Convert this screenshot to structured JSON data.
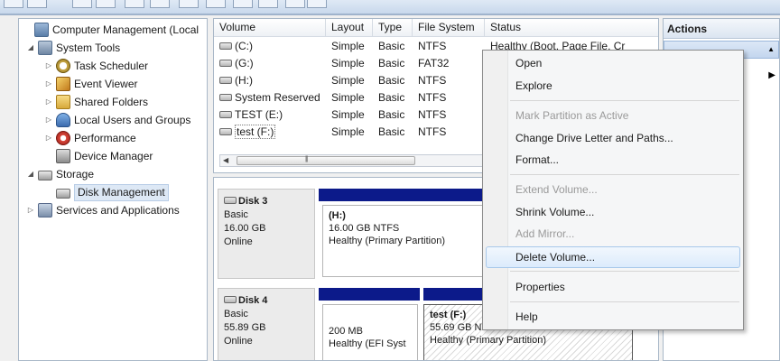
{
  "tree": {
    "items": [
      {
        "label": "Computer Management (Local",
        "icon": "computer-management-icon",
        "twisty": "",
        "level": 0
      },
      {
        "label": "System Tools",
        "icon": "system-tools-icon",
        "twisty": "◢",
        "level": 1
      },
      {
        "label": "Task Scheduler",
        "icon": "clock-icon",
        "twisty": "▷",
        "level": 2
      },
      {
        "label": "Event Viewer",
        "icon": "event-viewer-icon",
        "twisty": "▷",
        "level": 2
      },
      {
        "label": "Shared Folders",
        "icon": "shared-folder-icon",
        "twisty": "▷",
        "level": 2
      },
      {
        "label": "Local Users and Groups",
        "icon": "users-icon",
        "twisty": "▷",
        "level": 2
      },
      {
        "label": "Performance",
        "icon": "performance-icon",
        "twisty": "▷",
        "level": 2
      },
      {
        "label": "Device Manager",
        "icon": "device-manager-icon",
        "twisty": "",
        "level": 2
      },
      {
        "label": "Storage",
        "icon": "storage-icon",
        "twisty": "◢",
        "level": 1
      },
      {
        "label": "Disk Management",
        "icon": "disk-management-icon",
        "twisty": "",
        "level": 2
      },
      {
        "label": "Services and Applications",
        "icon": "services-icon",
        "twisty": "▷",
        "level": 1
      }
    ]
  },
  "volumes": {
    "headers": [
      "Volume",
      "Layout",
      "Type",
      "File System",
      "Status"
    ],
    "rows": [
      {
        "volume": "(C:)",
        "layout": "Simple",
        "type": "Basic",
        "fs": "NTFS",
        "status": "Healthy (Boot, Page File, Cr"
      },
      {
        "volume": "(G:)",
        "layout": "Simple",
        "type": "Basic",
        "fs": "FAT32",
        "status": ""
      },
      {
        "volume": "(H:)",
        "layout": "Simple",
        "type": "Basic",
        "fs": "NTFS",
        "status": ""
      },
      {
        "volume": "System Reserved",
        "layout": "Simple",
        "type": "Basic",
        "fs": "NTFS",
        "status": ""
      },
      {
        "volume": "TEST (E:)",
        "layout": "Simple",
        "type": "Basic",
        "fs": "NTFS",
        "status": ""
      },
      {
        "volume": "test (F:)",
        "layout": "Simple",
        "type": "Basic",
        "fs": "NTFS",
        "status": ""
      }
    ]
  },
  "disks": [
    {
      "name": "Disk 3",
      "type": "Basic",
      "size": "16.00 GB",
      "state": "Online",
      "partitions": [
        {
          "title": "(H:)",
          "detail": "16.00 GB NTFS",
          "status": "Healthy (Primary Partition)"
        }
      ]
    },
    {
      "name": "Disk 4",
      "type": "Basic",
      "size": "55.89 GB",
      "state": "Online",
      "partitions": [
        {
          "title": "",
          "detail": "200 MB",
          "status": "Healthy (EFI Syst"
        },
        {
          "title": "test (F:)",
          "detail": "55.69 GB NTFS",
          "status": "Healthy (Primary Partition)"
        }
      ]
    }
  ],
  "actions": {
    "header": "Actions"
  },
  "context_menu": {
    "items": [
      {
        "label": "Open",
        "enabled": true
      },
      {
        "label": "Explore",
        "enabled": true
      },
      {
        "label": "Mark Partition as Active",
        "enabled": false
      },
      {
        "label": "Change Drive Letter and Paths...",
        "enabled": true
      },
      {
        "label": "Format...",
        "enabled": true
      },
      {
        "label": "Extend Volume...",
        "enabled": false
      },
      {
        "label": "Shrink Volume...",
        "enabled": true
      },
      {
        "label": "Add Mirror...",
        "enabled": false
      },
      {
        "label": "Delete Volume...",
        "enabled": true,
        "highlighted": true
      },
      {
        "label": "Properties",
        "enabled": true
      },
      {
        "label": "Help",
        "enabled": true
      }
    ]
  },
  "colors": {
    "partition_bar": "#0c1a8a",
    "selection": "#dce8f6"
  }
}
